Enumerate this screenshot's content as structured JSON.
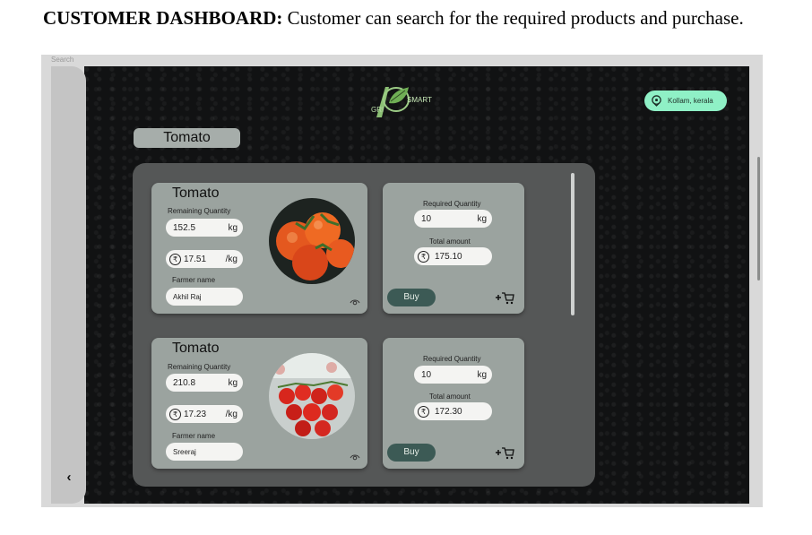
{
  "caption": {
    "bold": "CUSTOMER DASHBOARD:",
    "rest": " Customer can search for the required products and purchase."
  },
  "search_label": "Search",
  "logo": {
    "gri": "GRI",
    "smart": "SMART",
    "icon": "leaf-logo"
  },
  "location": {
    "text": "Kollam, kerala",
    "icon": "location-pin-icon"
  },
  "product_title": "Tomato",
  "back_icon": "‹",
  "colors": {
    "accent_location": "#8ff0c6",
    "buy_button": "#3c5a55",
    "card": "#9ba39f",
    "panel": "#555757"
  },
  "listings": [
    {
      "name": "Tomato",
      "remaining_label": "Remaining Quantity",
      "remaining_value": "152.5",
      "remaining_unit": "kg",
      "price": "17.51",
      "price_unit": "/kg",
      "farmer_label": "Farmer name",
      "farmer": "Akhil Raj",
      "required_label": "Required Quantity",
      "required_value": "10",
      "required_unit": "kg",
      "total_label": "Total amount",
      "total_value": "175.10",
      "buy_label": "Buy",
      "cart_label": "+🛒"
    },
    {
      "name": "Tomato",
      "remaining_label": "Remaining Quantity",
      "remaining_value": "210.8",
      "remaining_unit": "kg",
      "price": "17.23",
      "price_unit": "/kg",
      "farmer_label": "Farmer name",
      "farmer": "Sreeraj",
      "required_label": "Required Quantity",
      "required_value": "10",
      "required_unit": "kg",
      "total_label": "Total amount",
      "total_value": "172.30",
      "buy_label": "Buy",
      "cart_label": "+🛒"
    }
  ]
}
